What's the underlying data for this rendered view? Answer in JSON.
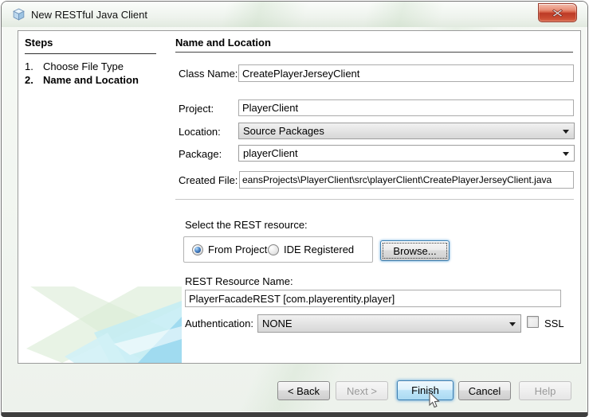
{
  "window": {
    "title": "New RESTful Java Client"
  },
  "icons": {
    "app": "cube-icon",
    "close": "✕",
    "dropdown": "▼"
  },
  "steps": {
    "heading": "Steps",
    "items": [
      {
        "num": "1.",
        "label": "Choose File Type"
      },
      {
        "num": "2.",
        "label": "Name and Location"
      }
    ]
  },
  "form": {
    "heading": "Name and Location",
    "class_name": {
      "label": "Class Name:",
      "value": "CreatePlayerJerseyClient"
    },
    "project": {
      "label": "Project:",
      "value": "PlayerClient"
    },
    "location": {
      "label": "Location:",
      "value": "Source Packages"
    },
    "package": {
      "label": "Package:",
      "value": "playerClient"
    },
    "created_file": {
      "label": "Created File:",
      "value": "eansProjects\\PlayerClient\\src\\playerClient\\CreatePlayerJerseyClient.java"
    },
    "rest_section": {
      "label": "Select the REST resource:",
      "radio_from_project": "From Project",
      "radio_ide_registered": "IDE Registered",
      "browse_label": "Browse..."
    },
    "resource_name": {
      "label": "REST Resource Name:",
      "value": "PlayerFacadeREST [com.playerentity.player]"
    },
    "authentication": {
      "label": "Authentication:",
      "value": "NONE",
      "ssl_label": "SSL"
    }
  },
  "buttons": {
    "back": "< Back",
    "next": "Next >",
    "finish": "Finish",
    "cancel": "Cancel",
    "help": "Help"
  },
  "colors": {
    "default_button_border": "#3c7fb1",
    "close_button_red": "#c94b31",
    "radio_selected_blue": "#2f62a8"
  }
}
